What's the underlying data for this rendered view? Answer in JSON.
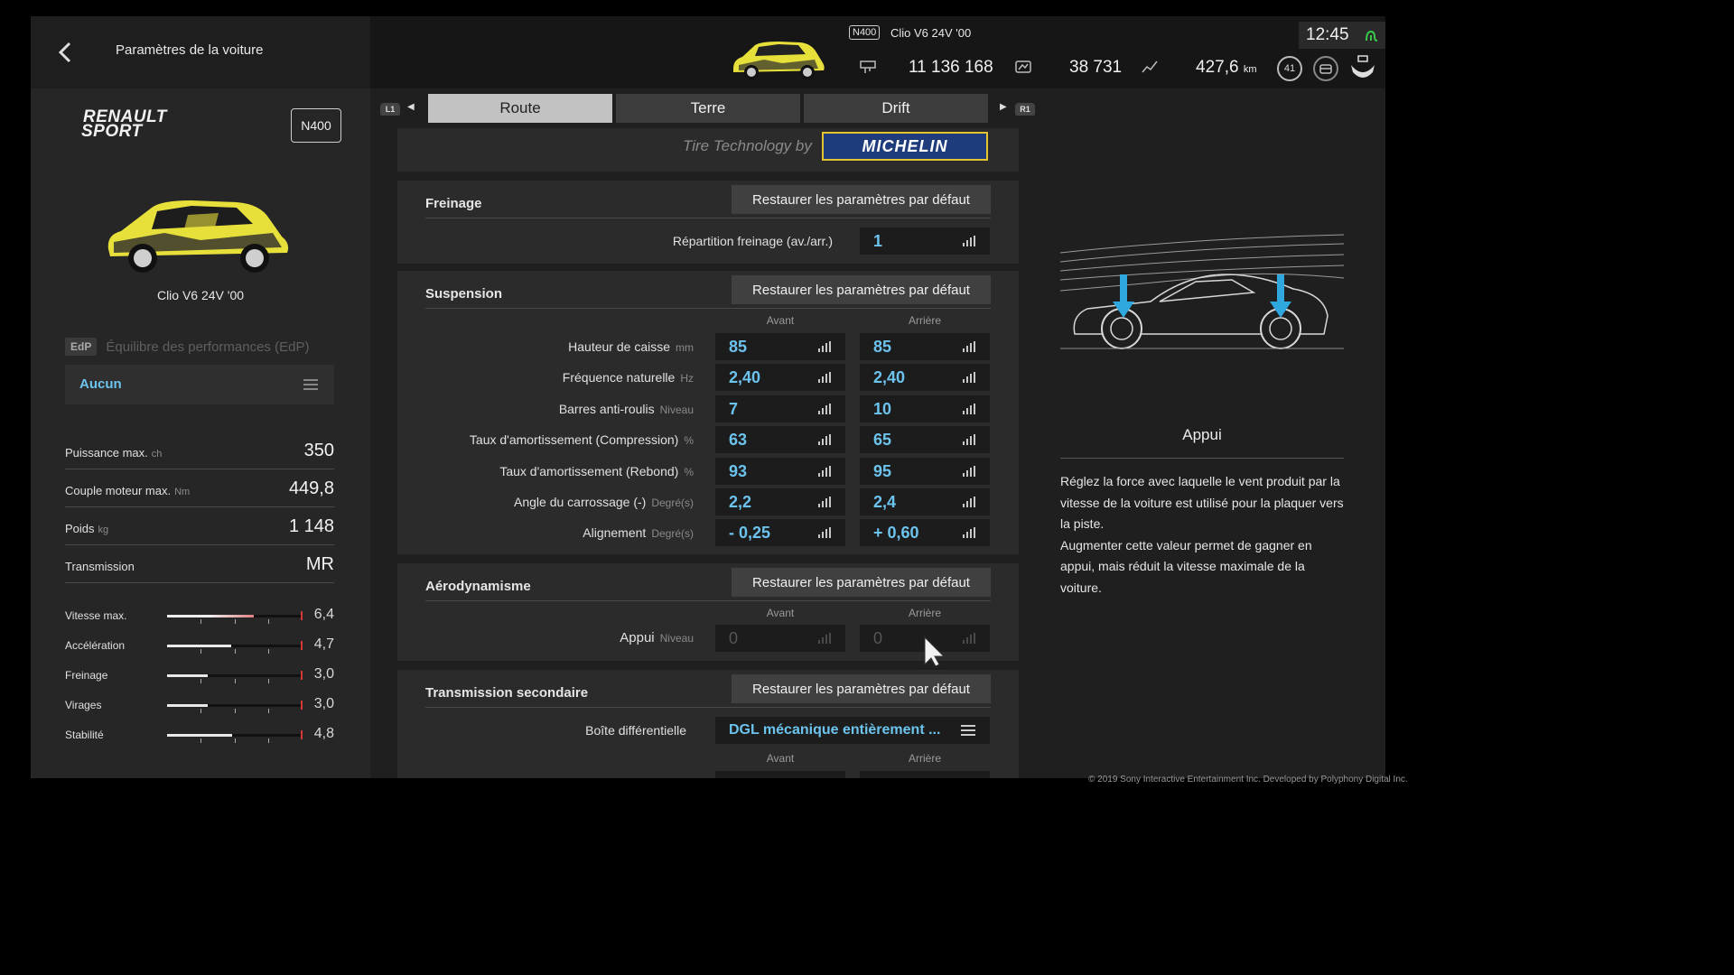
{
  "header": {
    "title": "Paramètres de la voiture",
    "car_class": "N400",
    "car_name": "Clio V6 24V '00",
    "credits": "11 136 168",
    "mileage_points": "38 731",
    "distance": "427,6",
    "distance_unit": "km",
    "clock": "12:45",
    "level": "41"
  },
  "car": {
    "brand_line1": "RENAULT",
    "brand_line2": "SPORT",
    "class": "N400",
    "name": "Clio V6 24V '00"
  },
  "bop": {
    "badge": "EdP",
    "label": "Équilibre des performances (EdP)",
    "value": "Aucun"
  },
  "specs": [
    {
      "label": "Puissance max.",
      "unit": "ch",
      "value": "350"
    },
    {
      "label": "Couple moteur max.",
      "unit": "Nm",
      "value": "449,8"
    },
    {
      "label": "Poids",
      "unit": "kg",
      "value": "1 148"
    },
    {
      "label": "Transmission",
      "unit": "",
      "value": "MR"
    }
  ],
  "performance": [
    {
      "label": "Vitesse max.",
      "value": "6,4",
      "fill": 0.64
    },
    {
      "label": "Accélération",
      "value": "4,7",
      "fill": 0.47
    },
    {
      "label": "Freinage",
      "value": "3,0",
      "fill": 0.3
    },
    {
      "label": "Virages",
      "value": "3,0",
      "fill": 0.3
    },
    {
      "label": "Stabilité",
      "value": "4,8",
      "fill": 0.48
    }
  ],
  "tabs": {
    "left_shoulder": "L1",
    "right_shoulder": "R1",
    "items": [
      {
        "label": "Route",
        "active": true
      },
      {
        "label": "Terre",
        "active": false
      },
      {
        "label": "Drift",
        "active": false
      }
    ]
  },
  "tires": {
    "tech_label": "Tire Technology by",
    "brand": "MICHELIN"
  },
  "reset_label": "Restaurer les paramètres par défaut",
  "columns": {
    "front": "Avant",
    "rear": "Arrière"
  },
  "braking": {
    "title": "Freinage",
    "param_label": "Répartition freinage (av./arr.)",
    "value": "1"
  },
  "suspension": {
    "title": "Suspension",
    "rows": [
      {
        "label": "Hauteur de caisse",
        "unit": "mm",
        "front": "85",
        "rear": "85"
      },
      {
        "label": "Fréquence naturelle",
        "unit": "Hz",
        "front": "2,40",
        "rear": "2,40"
      },
      {
        "label": "Barres anti-roulis",
        "unit": "Niveau",
        "front": "7",
        "rear": "10"
      },
      {
        "label": "Taux d'amortissement (Compression)",
        "unit": "%",
        "front": "63",
        "rear": "65"
      },
      {
        "label": "Taux d'amortissement (Rebond)",
        "unit": "%",
        "front": "93",
        "rear": "95"
      },
      {
        "label": "Angle du carrossage (-)",
        "unit": "Degré(s)",
        "front": "2,2",
        "rear": "2,4"
      },
      {
        "label": "Alignement",
        "unit": "Degré(s)",
        "front": "- 0,25",
        "rear": "+ 0,60"
      }
    ]
  },
  "aero": {
    "title": "Aérodynamisme",
    "param_label": "Appui",
    "unit": "Niveau",
    "front": "0",
    "rear": "0"
  },
  "differential": {
    "title": "Transmission secondaire",
    "param_label": "Boîte différentielle",
    "value": "DGL mécanique entièrement ..."
  },
  "info": {
    "title": "Appui",
    "text_1": "Réglez la force avec laquelle le vent produit par la vitesse de la voiture est utilisé pour la plaquer vers la piste.",
    "text_2": "Augmenter cette valeur permet de gagner en appui, mais réduit la vitesse maximale de la voiture."
  },
  "footer": {
    "copyright": "© 2019 Sony Interactive Entertainment Inc. Developed by Polyphony Digital Inc."
  }
}
